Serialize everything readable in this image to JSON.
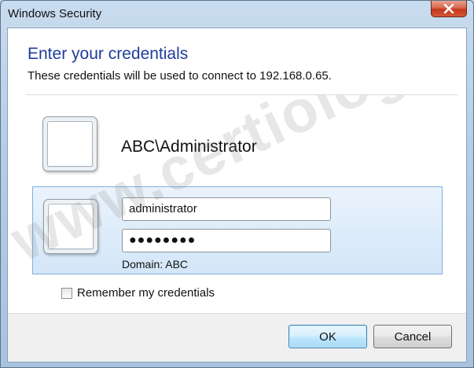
{
  "window": {
    "title": "Windows Security"
  },
  "dialog": {
    "heading": "Enter your credentials",
    "subtext": "These credentials will be used to connect to 192.168.0.65."
  },
  "saved_user": {
    "name": "ABC\\Administrator"
  },
  "credentials": {
    "username_value": "administrator",
    "password_mask": "●●●●●●●●",
    "domain_label": "Domain: ABC"
  },
  "remember": {
    "label": "Remember my credentials",
    "checked": false
  },
  "buttons": {
    "ok_label": "OK",
    "cancel_label": "Cancel"
  },
  "watermark": {
    "text": "www.certiology.com"
  },
  "colors": {
    "heading": "#1e3c9c",
    "close": "#c6361b",
    "panel": "#d3e6f8"
  }
}
